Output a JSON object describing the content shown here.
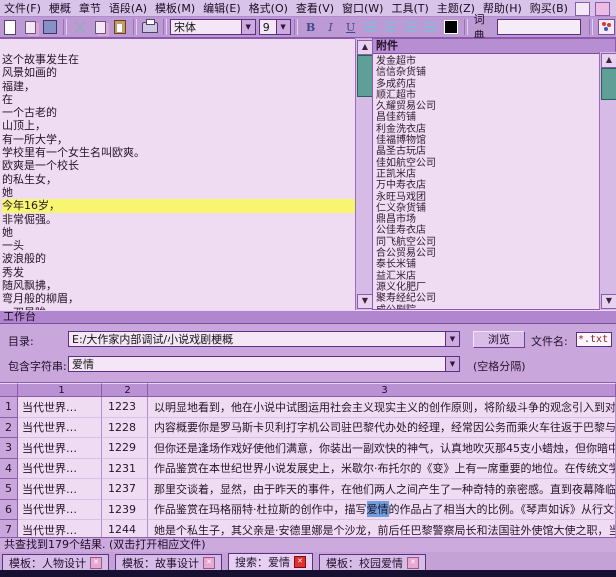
{
  "menu": {
    "items": [
      "文件(F)",
      "梗概",
      "章节",
      "语段(A)",
      "模板(M)",
      "编辑(E)",
      "格式(O)",
      "查看(V)",
      "窗口(W)",
      "工具(T)",
      "主题(Z)",
      "帮助(H)",
      "购买(B)"
    ]
  },
  "toolbar": {
    "font_name": "宋体",
    "font_size": "9",
    "bold_label": "B",
    "italic_label": "I",
    "underline_label": "U",
    "dictionary_label": "词典",
    "accent_black": "#000000"
  },
  "editor": {
    "lines": [
      "这个故事发生在",
      "风景如画的",
      "福建，",
      "在",
      "一个古老的",
      "山顶上，",
      "有一所大学，",
      "学校里有一个女生名叫欧爽。",
      "欧爽是一个校长",
      "的私生女，",
      "她",
      "今年16岁，",
      "非常倔强。",
      "她",
      "一头",
      "波浪般的",
      "秀发",
      "随风飘拂，",
      "弯月般的柳眉，",
      "一双星眸"
    ],
    "highlight_index": 11,
    "highlight_color": "#f8f570"
  },
  "attachments": {
    "title": "附件",
    "items": [
      "发金超市",
      "信信杂货铺",
      "多成药店",
      "顺汇超市",
      "久耀贸易公司",
      "昌佳药铺",
      "利金洗衣店",
      "佳福博物馆",
      "晶圣古玩店",
      "佳如航空公司",
      "正凯米店",
      "万中寿衣店",
      "永旺马戏团",
      "仁义杂货铺",
      "鼎昌市场",
      "公佳寿衣店",
      "同飞航空公司",
      "合公贸易公司",
      "泰长米铺",
      "益汇米店",
      "源义化肥厂",
      "聚寿经纪公司",
      "成公剧院"
    ]
  },
  "workbench": {
    "title": "工作台",
    "dir_label": "目录:",
    "dir_value": "E:/大作家内部调试/小说戏剧梗概",
    "browse_label": "浏览",
    "filename_label": "文件名:",
    "filename_value": "*.txt",
    "contains_label": "包含字符串:",
    "contains_value": "爱情",
    "hint": "(空格分隔)"
  },
  "results": {
    "columns": [
      "1",
      "2",
      "3"
    ],
    "rows": [
      {
        "n": "1",
        "c1": "当代世界…",
        "c2": "1223",
        "c3": "以明显地看到，他在小说中试图运用社会主义现实主义的创作原则，将阶级斗争的观念引入到对于"
      },
      {
        "n": "2",
        "c1": "当代世界…",
        "c2": "1228",
        "c3": "内容概要你是罗马斯卡贝利打字机公司驻巴黎代办处的经理，经常因公务而乘火车往返于巴黎与"
      },
      {
        "n": "3",
        "c1": "当代世界…",
        "c2": "1229",
        "c3": "但你还是逢场作戏好使他们满意，你装出一副欢快的神气，认真地吹灭那45支小蜡烛，但你暗中却"
      },
      {
        "n": "4",
        "c1": "当代世界…",
        "c2": "1231",
        "c3": "作品鉴赏在本世纪世界小说发展史上，米歇尔·布托尔的《变》上有一席重要的地位。在传统文学"
      },
      {
        "n": "5",
        "c1": "当代世界…",
        "c2": "1237",
        "c3": "那里交谈着，显然，由于昨天的事件，在他们两人之间产生了一种奇特的亲密感。直到夜幕降临，安"
      },
      {
        "n": "6",
        "c1": "当代世界…",
        "c2": "1239",
        "c3_pre": "作品鉴赏在玛格丽特·杜拉斯的创作中，描写",
        "c3_hl": "爱情",
        "c3_post": "的作品占了相当大的比例。《琴声如诉》从行文和"
      },
      {
        "n": "7",
        "c1": "当代世界…",
        "c2": "1244",
        "c3": "她是个私生子，其父亲是·安德里娜是个沙龙，前后任巴黎警察局长和法国驻外使馆大使之职，当"
      }
    ]
  },
  "statusbar": {
    "text": "共查找到179个结果.  (双击打开相应文件)"
  },
  "tabs": [
    {
      "label": "模板：人物设计"
    },
    {
      "label": "模板：故事设计"
    },
    {
      "label": "搜索：爱情",
      "active": true
    },
    {
      "label": "模板：校园爱情"
    }
  ]
}
